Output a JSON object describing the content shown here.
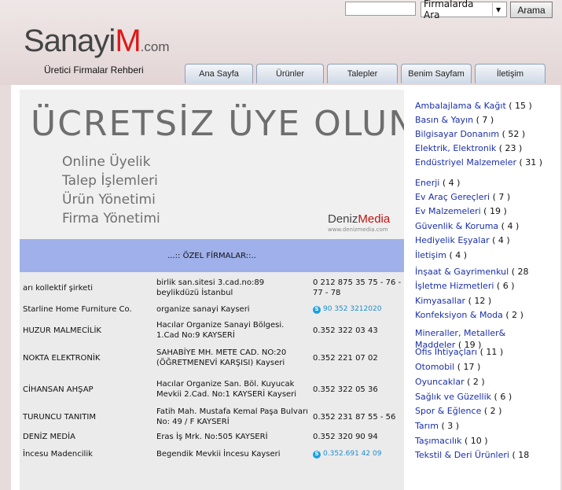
{
  "search": {
    "input_value": "",
    "select_value": "Firmalarda Ara",
    "button_label": "Arama"
  },
  "logo": {
    "part1": "Sanayi",
    "part2": "M",
    "part3": ".com"
  },
  "tagline": "Üretici  Firmalar Rehberi",
  "tabs": [
    {
      "label": "Ana Sayfa"
    },
    {
      "label": "Ürünler"
    },
    {
      "label": "Talepler"
    },
    {
      "label": "Benim Sayfam"
    },
    {
      "label": "İletişim"
    }
  ],
  "promo": {
    "title": "ÜCRETSİZ ÜYE OLUN",
    "lines": [
      "Online Üyelik",
      "Talep İşlemleri",
      "Ürün Yönetimi",
      "Firma Yönetimi"
    ],
    "brand1": "Deniz",
    "brand2": "Media",
    "brand_url": "www.denizmedia.com"
  },
  "firms_header": "...:: ÖZEL FİRMALAR::..",
  "firms": [
    {
      "name": "arı kollektif şirketi",
      "address": "birlik san.sitesi 3.cad.no:89 beylikdüzü     İstanbul",
      "phone": "0 212 875 35 75 - 76 - 77 - 78",
      "skype": false
    },
    {
      "name": "Starline Home Furniture Co.",
      "address": "organize sanayi    Kayseri",
      "phone": "90 352 3212020",
      "skype": true
    },
    {
      "name": "HUZUR MALMECİLİK",
      "address": "Hacılar Organize Sanayi Bölgesi. 1.Cad No:9 KAYSERİ",
      "phone": "0.352 322 03 43",
      "skype": false
    },
    {
      "name": "NOKTA ELEKTRONİK",
      "address": "SAHABİYE MH. METE CAD. NO:20 (ÖĞRETMENEVİ KARŞISI)    Kayseri",
      "phone": "0.352 221 07 02",
      "skype": false
    },
    {
      "name": "CİHANSAN AHŞAP",
      "address": "Hacılar Organize San. Böl. Kuyucak Mevkii 2.Cad. No:1 KAYSERİ     Kayseri",
      "phone": "0.352 322 05 36",
      "skype": false
    },
    {
      "name": "TURUNCU TANITIM",
      "address": "Fatih Mah. Mustafa Kemal Paşa Bulvarı No: 49 / F    KAYSERİ",
      "phone": "0.352 231 87 55 - 56",
      "skype": false
    },
    {
      "name": "DENİZ MEDİA",
      "address": "Eras İş Mrk. No:505    KAYSERİ",
      "phone": "0.352 320 90 94",
      "skype": false
    },
    {
      "name": "İncesu Madencilik",
      "address": "Begendik Mevkii İncesu Kayseri",
      "phone": "0.352.691 42 09",
      "skype": true
    }
  ],
  "categories": [
    {
      "label": "Ambalajlama & Kağıt",
      "count": "( 15 )"
    },
    {
      "label": "Basın & Yayın",
      "count": "( 7 )"
    },
    {
      "label": "Bilgisayar Donanım",
      "count": "( 52 )"
    },
    {
      "label": "Elektrik, Elektronik",
      "count": "( 23 )"
    },
    {
      "label": "Endüstriyel Malzemeler",
      "count": "( 31 )"
    },
    {
      "label": "Enerji",
      "count": "( 4 )"
    },
    {
      "label": "Ev Araç Gereçleri",
      "count": "( 7 )"
    },
    {
      "label": "Ev Malzemeleri",
      "count": "( 19 )"
    },
    {
      "label": "Güvenlik & Koruma",
      "count": "( 4 )"
    },
    {
      "label": "Hediyelik Eşyalar",
      "count": "( 4 )"
    },
    {
      "label": "İletişim",
      "count": "( 4 )"
    },
    {
      "label": "İnşaat & Gayrimenkul",
      "count": "( 28"
    },
    {
      "label": "İşletme Hizmetleri",
      "count": "( 6 )"
    },
    {
      "label": "Kimyasallar",
      "count": "( 12 )"
    },
    {
      "label": "Konfeksiyon & Moda",
      "count": "( 2 )"
    },
    {
      "label": "Mineraller, Metaller& Maddeler",
      "count": "( 19 )"
    },
    {
      "label": "Ofis İhtiyaçları",
      "count": "( 11 )"
    },
    {
      "label": "Otomobil",
      "count": "( 17 )"
    },
    {
      "label": "Oyuncaklar",
      "count": "( 2 )"
    },
    {
      "label": "Sağlık ve Güzellik",
      "count": "( 6 )"
    },
    {
      "label": "Spor & Eğlence",
      "count": "( 2 )"
    },
    {
      "label": "Tarım",
      "count": "( 3 )"
    },
    {
      "label": "Taşımacılık",
      "count": "( 10 )"
    },
    {
      "label": "Tekstil & Deri Ürünleri",
      "count": "( 18"
    }
  ]
}
